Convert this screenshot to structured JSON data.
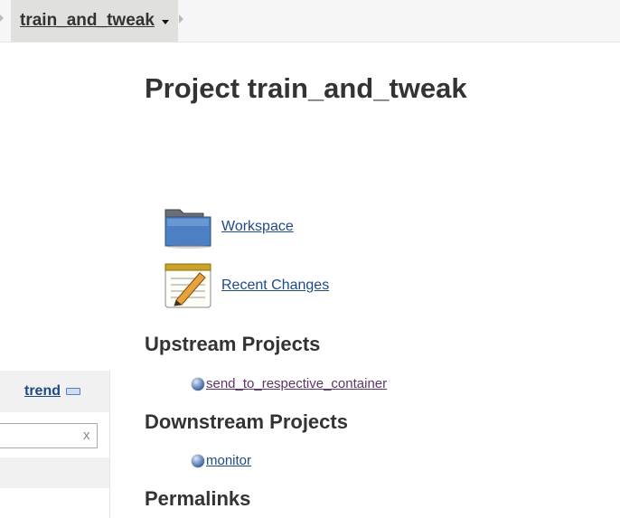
{
  "breadcrumb": {
    "project": "train_and_tweak"
  },
  "page": {
    "title": "Project train_and_tweak"
  },
  "tasks": [
    {
      "label": "Workspace",
      "icon": "folder-icon"
    },
    {
      "label": "Recent Changes",
      "icon": "notepad-icon"
    }
  ],
  "upstream": {
    "heading": "Upstream Projects",
    "items": [
      {
        "label": "send_to_respective_container",
        "color": "#5c3566"
      }
    ]
  },
  "downstream": {
    "heading": "Downstream Projects",
    "items": [
      {
        "label": "monitor",
        "color": "#204a87"
      }
    ]
  },
  "permalinks": {
    "heading": "Permalinks"
  },
  "sidebar": {
    "trend_label": "trend",
    "filter_clear": "x"
  },
  "colors": {
    "link": "#204a87",
    "visited_link": "#5c3566",
    "breadcrumb_bg": "#e0e1dc"
  }
}
